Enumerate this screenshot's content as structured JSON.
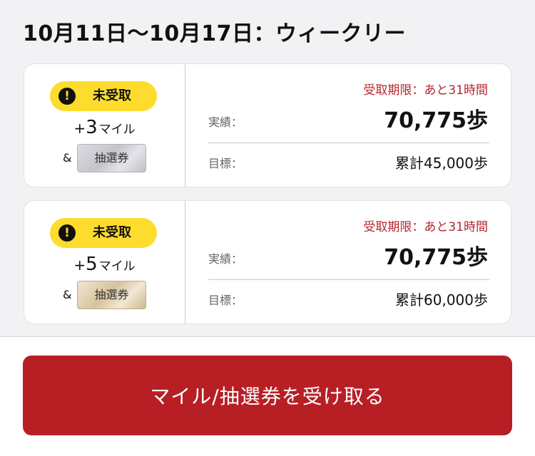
{
  "header": {
    "title": "10月11日〜10月17日：ウィークリー"
  },
  "cards": [
    {
      "status": "未受取",
      "reward": {
        "plus": "+",
        "miles": "3",
        "unit": "マイル",
        "amp": "&",
        "ticket_label": "抽選券",
        "ticket_tier": "silver"
      },
      "deadline": "受取期限：あと31時間",
      "result_label": "実績：",
      "result_value": "70,775歩",
      "goal_label": "目標：",
      "goal_value": "累計45,000歩"
    },
    {
      "status": "未受取",
      "reward": {
        "plus": "+",
        "miles": "5",
        "unit": "マイル",
        "amp": "&",
        "ticket_label": "抽選券",
        "ticket_tier": "gold"
      },
      "deadline": "受取期限：あと31時間",
      "result_label": "実績：",
      "result_value": "70,775歩",
      "goal_label": "目標：",
      "goal_value": "累計60,000歩"
    }
  ],
  "icons": {
    "alert": "!"
  },
  "colors": {
    "accent_red": "#b71f25",
    "badge_yellow": "#fddc2d",
    "deadline_red": "#b3262d"
  },
  "footer": {
    "claim_label": "マイル/抽選券を受け取る"
  }
}
